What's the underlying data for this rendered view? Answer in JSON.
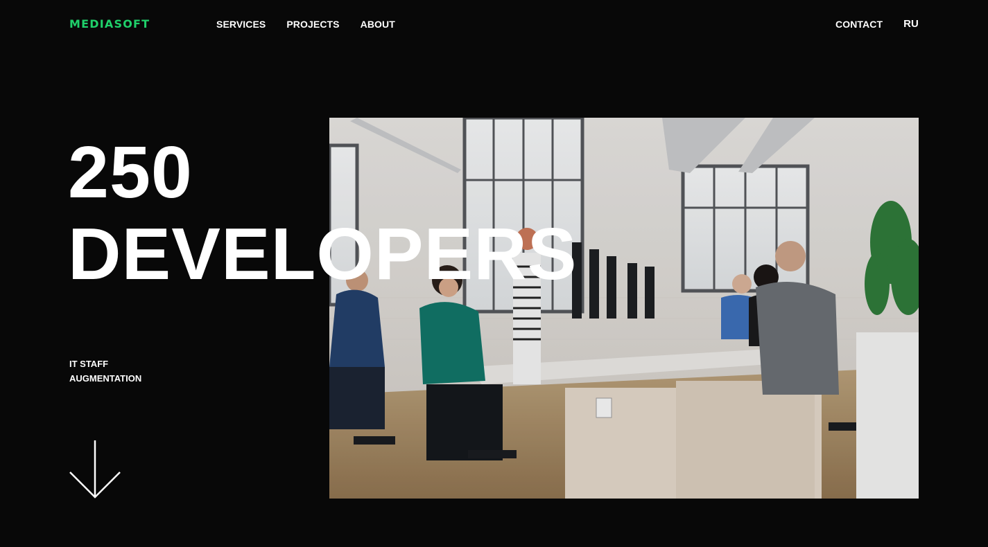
{
  "header": {
    "logo": "MEDIASOFT",
    "nav": [
      {
        "label": "SERVICES"
      },
      {
        "label": "PROJECTS"
      },
      {
        "label": "ABOUT"
      }
    ],
    "contact_label": "CONTACT",
    "language_label": "RU"
  },
  "hero": {
    "headline_line1": "250",
    "headline_line2": "DEVELOPERS",
    "subtitle_line1": "IT STAFF",
    "subtitle_line2": "AUGMENTATION",
    "scroll_icon": "arrow-down-icon",
    "photo_subject": "office-team-photo"
  },
  "colors": {
    "background": "#080808",
    "brand": "#1fd06a",
    "text": "#ffffff"
  }
}
